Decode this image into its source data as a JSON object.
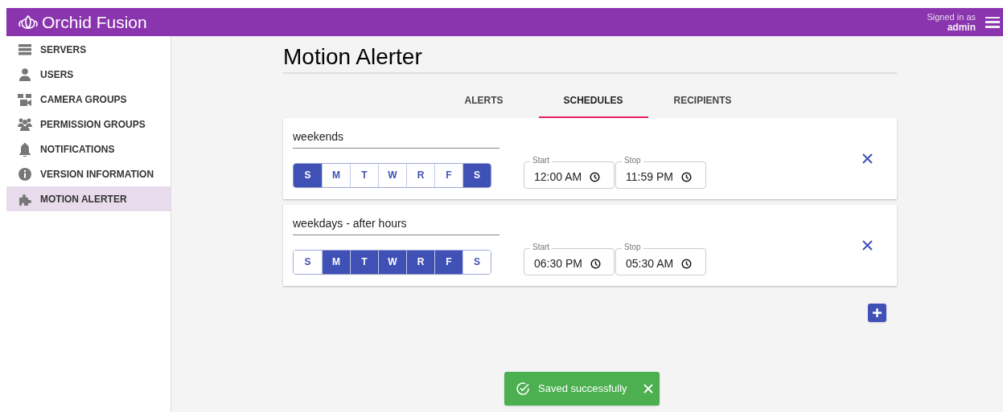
{
  "header": {
    "brand": "Orchid Fusion",
    "signed_in_label": "Signed in as",
    "user": "admin"
  },
  "sidebar": {
    "items": [
      {
        "label": "SERVERS",
        "selected": false
      },
      {
        "label": "USERS",
        "selected": false
      },
      {
        "label": "CAMERA GROUPS",
        "selected": false
      },
      {
        "label": "PERMISSION GROUPS",
        "selected": false
      },
      {
        "label": "NOTIFICATIONS",
        "selected": false
      },
      {
        "label": "VERSION INFORMATION",
        "selected": false
      },
      {
        "label": "MOTION ALERTER",
        "selected": true
      }
    ]
  },
  "page": {
    "title": "Motion Alerter"
  },
  "tabs": [
    {
      "label": "ALERTS",
      "selected": false
    },
    {
      "label": "SCHEDULES",
      "selected": true
    },
    {
      "label": "RECIPIENTS",
      "selected": false
    }
  ],
  "schedules": [
    {
      "name": "weekends",
      "days": [
        {
          "label": "S",
          "selected": true
        },
        {
          "label": "M",
          "selected": false
        },
        {
          "label": "T",
          "selected": false
        },
        {
          "label": "W",
          "selected": false
        },
        {
          "label": "R",
          "selected": false
        },
        {
          "label": "F",
          "selected": false
        },
        {
          "label": "S",
          "selected": true
        }
      ],
      "start_label": "Start",
      "start": "12:00 AM",
      "stop_label": "Stop",
      "stop": "11:59 PM"
    },
    {
      "name": "weekdays - after hours",
      "days": [
        {
          "label": "S",
          "selected": false
        },
        {
          "label": "M",
          "selected": true
        },
        {
          "label": "T",
          "selected": true
        },
        {
          "label": "W",
          "selected": true
        },
        {
          "label": "R",
          "selected": true
        },
        {
          "label": "F",
          "selected": true
        },
        {
          "label": "S",
          "selected": false
        }
      ],
      "start_label": "Start",
      "start": "06:30 PM",
      "stop_label": "Stop",
      "stop": "05:30 AM"
    }
  ],
  "toast": {
    "message": "Saved successfully"
  }
}
